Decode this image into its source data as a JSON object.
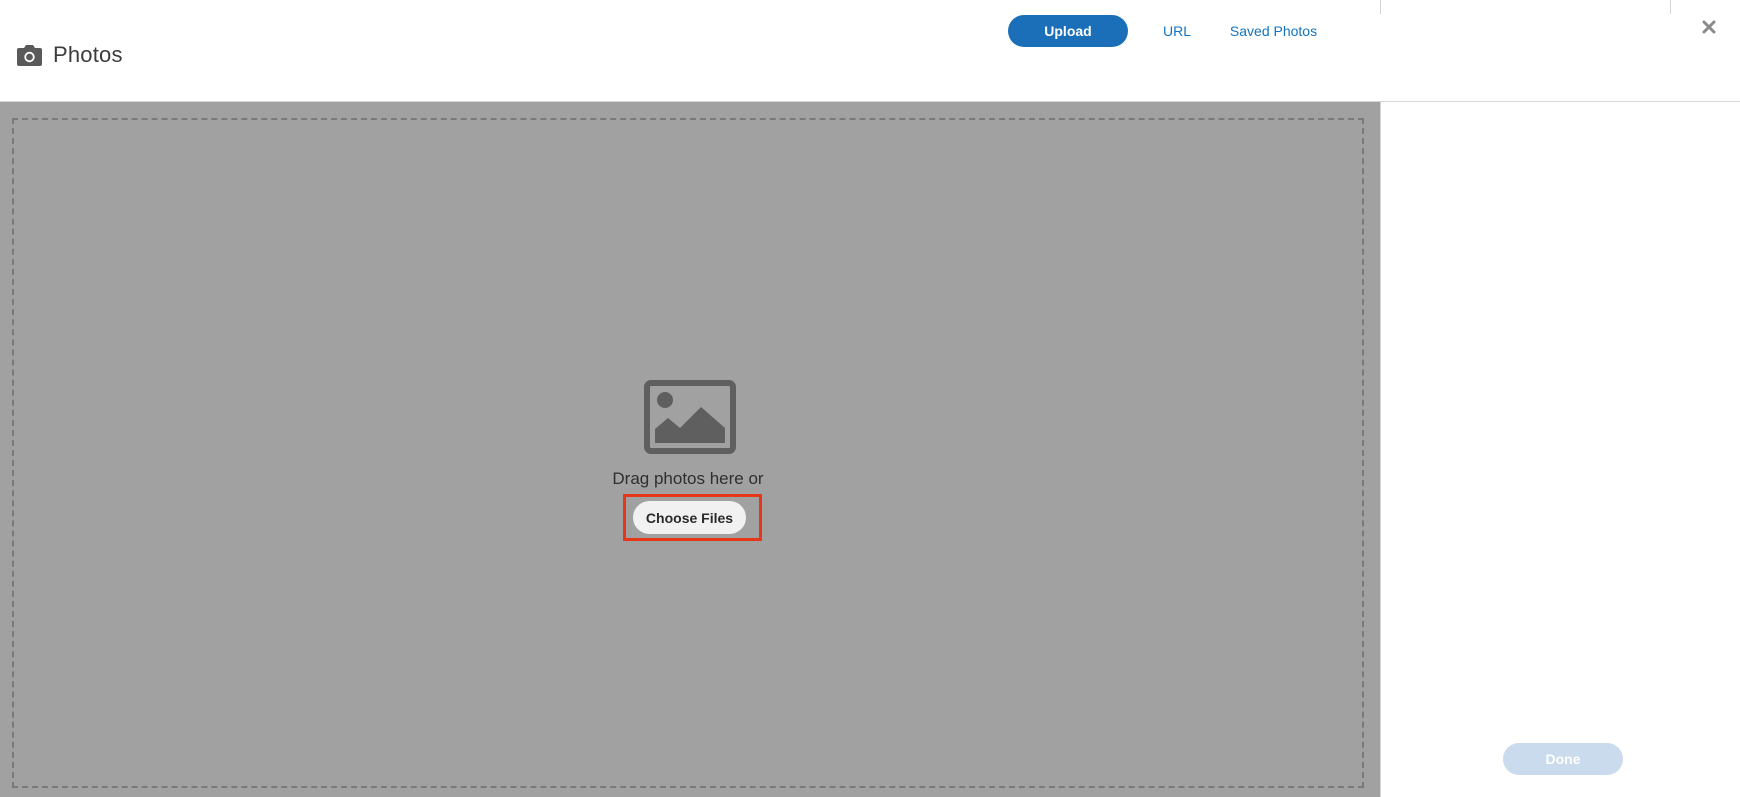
{
  "header": {
    "title": "Photos",
    "icon": "camera-icon",
    "tabs": [
      {
        "label": "Upload",
        "active": true
      },
      {
        "label": "URL",
        "active": false
      },
      {
        "label": "Saved Photos",
        "active": false
      }
    ],
    "close_icon": "close-icon"
  },
  "drop_zone": {
    "icon": "image-icon",
    "prompt": "Drag photos here or",
    "choose_label": "Choose Files"
  },
  "side_panel": {
    "done_label": "Done",
    "done_enabled": false
  },
  "colors": {
    "accent": "#1a6fb8",
    "link": "#1473c0",
    "drop_background": "#a1a1a1",
    "highlight": "#e8361a",
    "done_disabled": "#c9dbed"
  }
}
